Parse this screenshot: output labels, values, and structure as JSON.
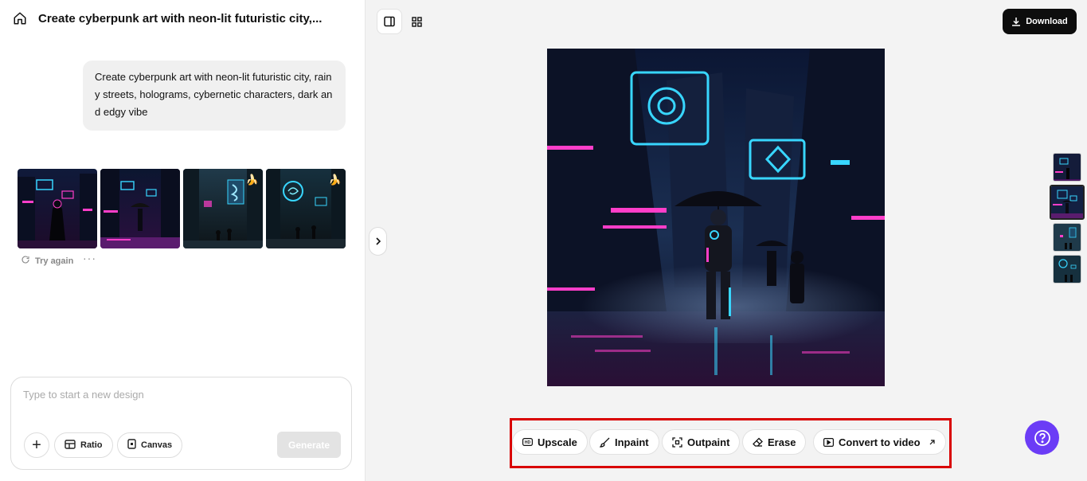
{
  "header": {
    "title": "Create cyberpunk art with neon-lit futuristic city,..."
  },
  "chat": {
    "prompt": "Create cyberpunk art with neon-lit futuristic city, rainy streets, holograms, cybernetic characters, dark and edgy vibe",
    "try_again": "Try again",
    "more": "···",
    "thumbnails": [
      {
        "name": "result-1",
        "badge": ""
      },
      {
        "name": "result-2",
        "badge": ""
      },
      {
        "name": "result-3",
        "badge": "banana"
      },
      {
        "name": "result-4",
        "badge": "banana"
      }
    ]
  },
  "composer": {
    "placeholder": "Type to start a new design",
    "ratio_label": "Ratio",
    "canvas_label": "Canvas",
    "generate_label": "Generate"
  },
  "toolbar": {
    "download_label": "Download"
  },
  "actions": {
    "upscale": "Upscale",
    "inpaint": "Inpaint",
    "outpaint": "Outpaint",
    "erase": "Erase",
    "convert": "Convert to video"
  },
  "colors": {
    "accent": "#6b3cf6",
    "highlight_frame": "#d90000",
    "neon_pink": "#ff3ec9",
    "neon_cyan": "#38d6ff"
  }
}
